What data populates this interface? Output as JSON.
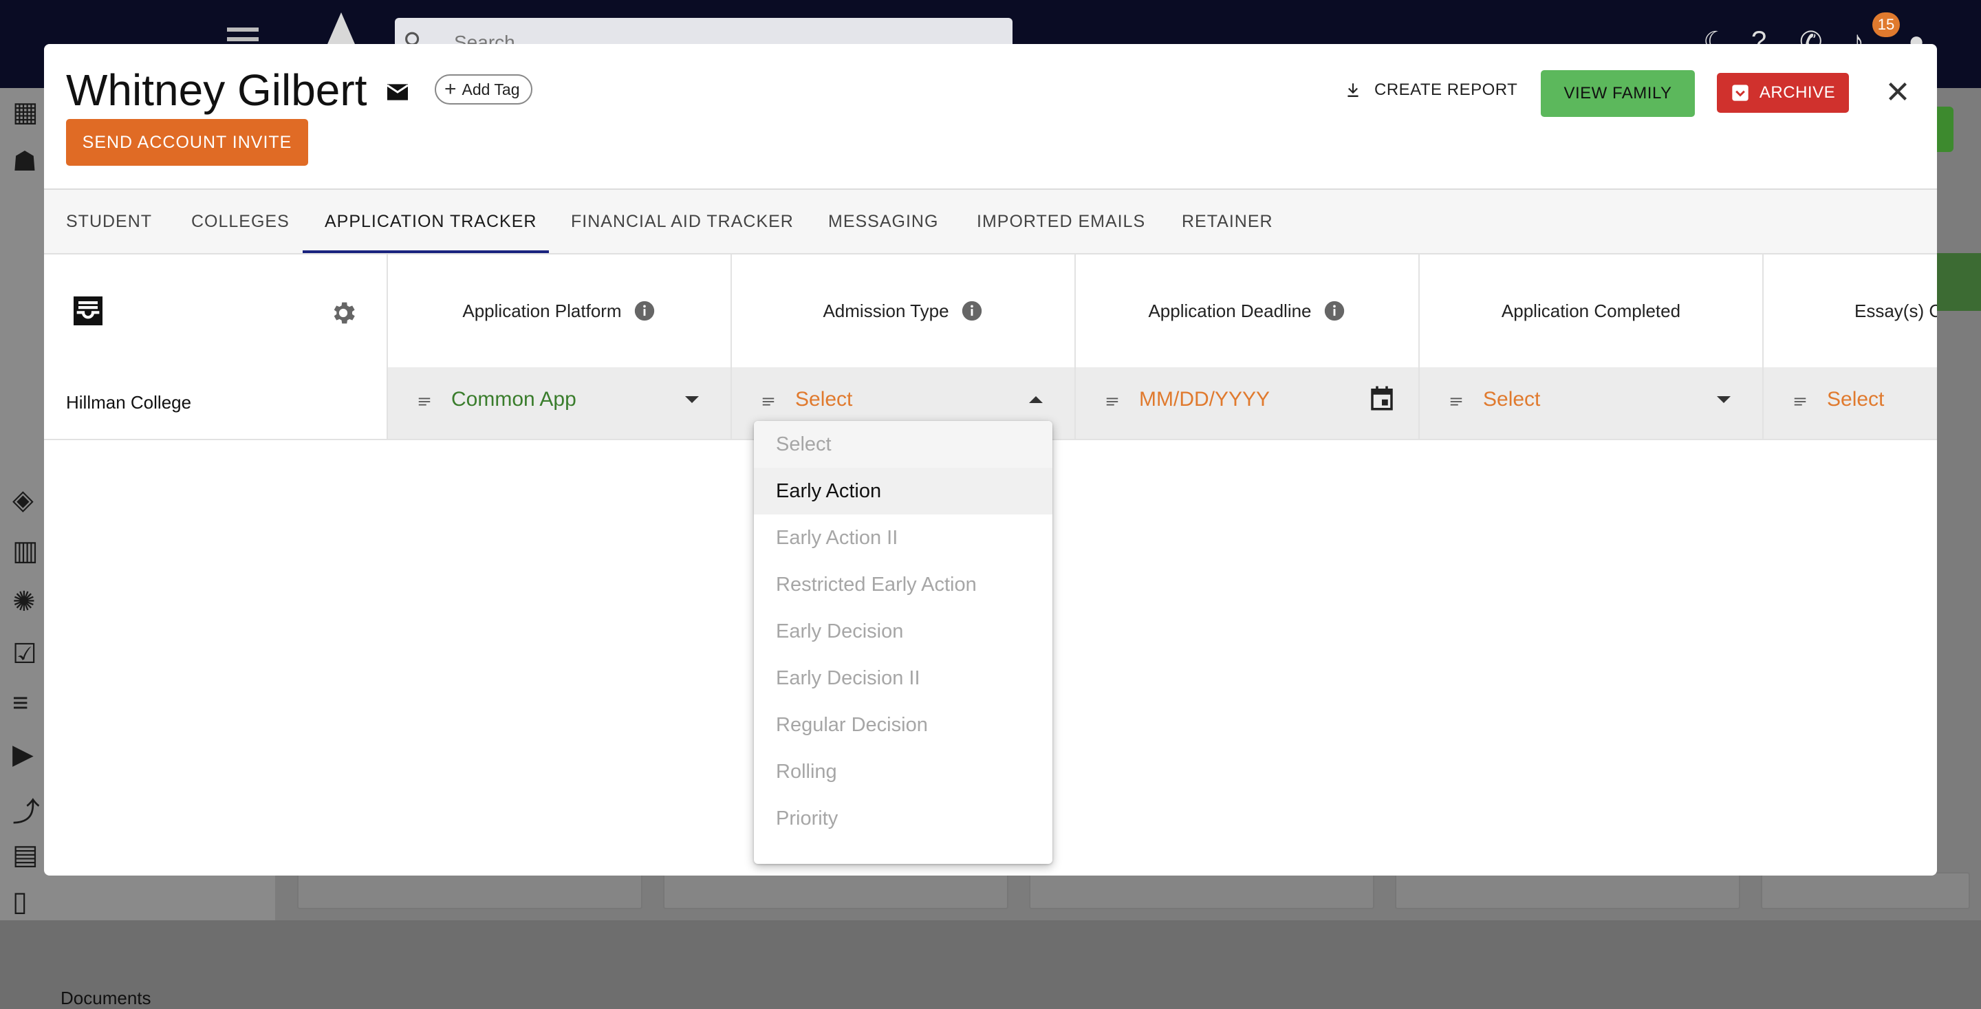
{
  "background": {
    "search_placeholder": "Search",
    "notification_count": "15",
    "sidebar_label": "Documents"
  },
  "header": {
    "student_name": "Whitney Gilbert",
    "add_tag_label": "Add Tag",
    "send_invite_label": "SEND ACCOUNT INVITE",
    "create_report_label": "CREATE REPORT",
    "view_family_label": "VIEW FAMILY",
    "archive_label": "ARCHIVE"
  },
  "tabs": [
    {
      "label": "STUDENT"
    },
    {
      "label": "COLLEGES"
    },
    {
      "label": "APPLICATION TRACKER",
      "active": true
    },
    {
      "label": "FINANCIAL AID TRACKER"
    },
    {
      "label": "MESSAGING"
    },
    {
      "label": "IMPORTED EMAILS"
    },
    {
      "label": "RETAINER"
    }
  ],
  "tracker": {
    "columns": [
      {
        "label": "Application Platform",
        "info": true
      },
      {
        "label": "Admission Type",
        "info": true
      },
      {
        "label": "Application Deadline",
        "info": true
      },
      {
        "label": "Application Completed",
        "info": false
      },
      {
        "label": "Essay(s) C",
        "info": false
      }
    ],
    "rows": [
      {
        "college": "Hillman College",
        "application_platform": "Common App",
        "admission_type": "Select",
        "application_deadline": "MM/DD/YYYY",
        "application_completed": "Select",
        "essays": "Select"
      }
    ]
  },
  "admission_type_dropdown": {
    "placeholder": "Select",
    "hovered": "Early Action",
    "options": [
      "Early Action",
      "Early Action II",
      "Restricted Early Action",
      "Early Decision",
      "Early Decision II",
      "Regular Decision",
      "Rolling",
      "Priority"
    ]
  },
  "colors": {
    "accent_orange": "#e06b25",
    "success_green": "#5cb85c",
    "danger_red": "#d0312d",
    "tab_indicator": "#1a237e",
    "filled_value_green": "#3a7d2c",
    "placeholder_orange": "#e07a2e",
    "topbar_navy": "#0a0c24"
  }
}
